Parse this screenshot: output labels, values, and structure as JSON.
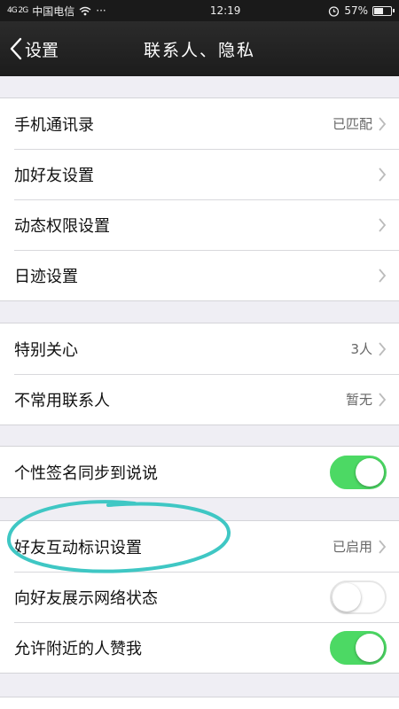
{
  "status_bar": {
    "signal_text": "4G 2G",
    "carrier": "中国电信",
    "dots": "···",
    "time": "12:19",
    "battery": "57%",
    "battery_level": 0.57,
    "icons": [
      "signal-icon",
      "wifi-icon",
      "alarm-icon",
      "battery-icon"
    ]
  },
  "nav": {
    "back_label": "设置",
    "title": "联系人、隐私"
  },
  "group1": [
    {
      "label": "手机通讯录",
      "value": "已匹配"
    },
    {
      "label": "加好友设置",
      "value": ""
    },
    {
      "label": "动态权限设置",
      "value": ""
    },
    {
      "label": "日迹设置",
      "value": ""
    }
  ],
  "group2": [
    {
      "label": "特别关心",
      "value": "3人"
    },
    {
      "label": "不常用联系人",
      "value": "暂无"
    }
  ],
  "group3": [
    {
      "label": "个性签名同步到说说",
      "toggle": true
    },
    {
      "label": "好友互动标识设置",
      "value": "已启用"
    },
    {
      "label": "向好友展示网络状态",
      "toggle": false
    },
    {
      "label": "允许附近的人赞我",
      "toggle": true
    }
  ],
  "colors": {
    "toggle_on": "#4cd964",
    "annotation_circle": "#3fc7c4",
    "nav_bg": "#1f1f1f"
  }
}
